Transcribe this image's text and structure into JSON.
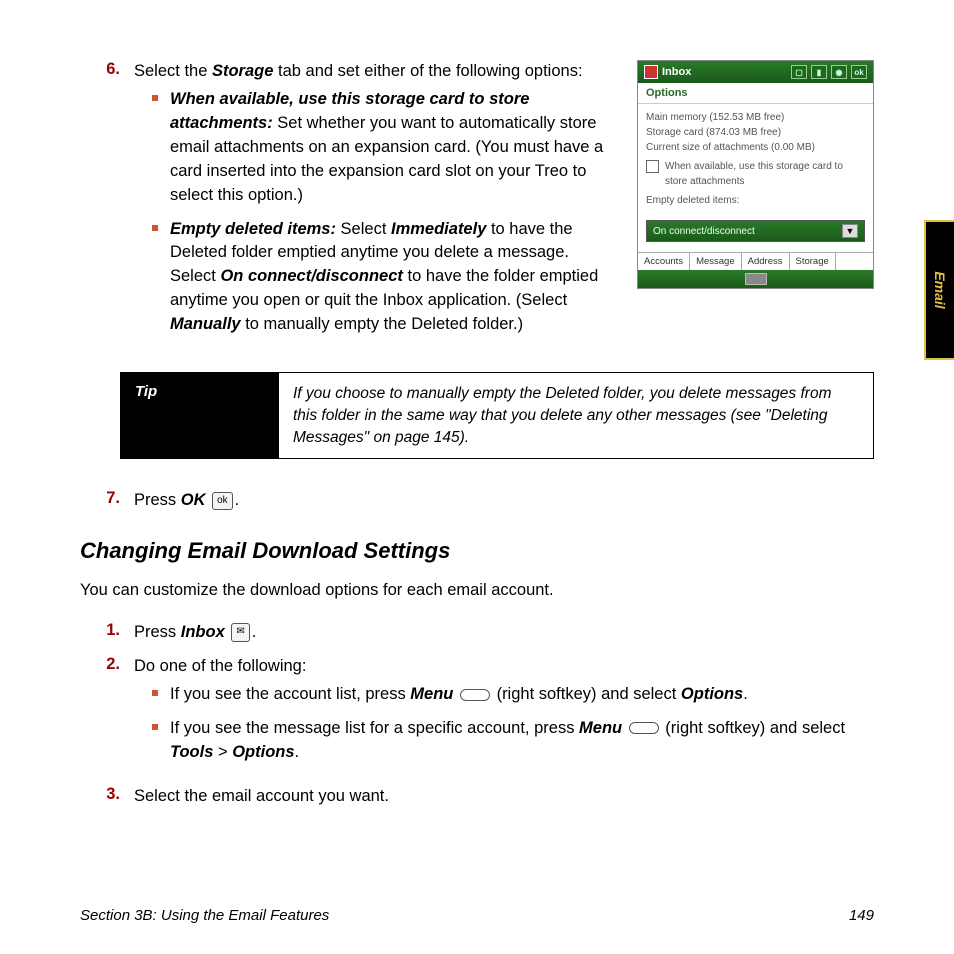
{
  "sidebar": {
    "label": "Email"
  },
  "step6": {
    "num": "6.",
    "intro_a": "Select the ",
    "intro_b_bold": "Storage",
    "intro_c": " tab and set either of the following options:",
    "bullet1_title": "When available, use this storage card to store attachments:",
    "bullet1_body": " Set whether you want to automatically store email attachments on an expansion card. (You must have a card inserted into the expansion card slot on your Treo to select this option.)",
    "bullet2_title": "Empty deleted items:",
    "bullet2_body_a": " Select ",
    "bullet2_b1": "Immediately",
    "bullet2_body_b": " to have the Deleted folder emptied anytime you delete a message. Select ",
    "bullet2_b2": "On connect/disconnect",
    "bullet2_body_c": " to have the folder emptied anytime you open or quit the Inbox application. (Select ",
    "bullet2_b3": "Manually",
    "bullet2_body_d": " to manually empty the Deleted folder.)"
  },
  "screenshot": {
    "title": "Inbox",
    "ok": "ok",
    "options": "Options",
    "line1": "Main memory (152.53 MB free)",
    "line2": "Storage card (874.03 MB free)",
    "line3": "Current size of attachments (0.00 MB)",
    "check_label": "When available, use this storage card to store attachments",
    "empty_label": "Empty deleted items:",
    "dropdown_value": "On connect/disconnect",
    "tabs": {
      "t1": "Accounts",
      "t2": "Message",
      "t3": "Address",
      "t4": "Storage"
    }
  },
  "tip": {
    "label": "Tip",
    "body": "If you choose to manually empty the Deleted folder, you delete messages from this folder in the same way that you delete any other messages (see \"Deleting Messages\" on page 145)."
  },
  "step7": {
    "num": "7.",
    "a": "Press ",
    "b_bold": "OK",
    "c": " ",
    "pill": "ok",
    "d": "."
  },
  "heading": "Changing Email Download Settings",
  "intro2": "You can customize the download options for each email account.",
  "step1": {
    "num": "1.",
    "a": "Press ",
    "b_bold": "Inbox",
    "c": " ",
    "pill": "✉",
    "d": "."
  },
  "step2": {
    "num": "2.",
    "intro": "Do one of the following:",
    "b1a": "If you see the account list, press ",
    "b1b": "Menu",
    "b1c": " ",
    "b1d": " (right softkey) and select ",
    "b1e": "Options",
    "b1f": ".",
    "b2a": "If you see the message list for a specific account, press ",
    "b2b": "Menu",
    "b2c": " ",
    "b2d": " (right softkey) and select ",
    "b2e": "Tools",
    "b2f": " > ",
    "b2g": "Options",
    "b2h": "."
  },
  "step3": {
    "num": "3.",
    "text": "Select the email account you want."
  },
  "footer": {
    "left": "Section 3B: Using the Email Features",
    "right": "149"
  }
}
